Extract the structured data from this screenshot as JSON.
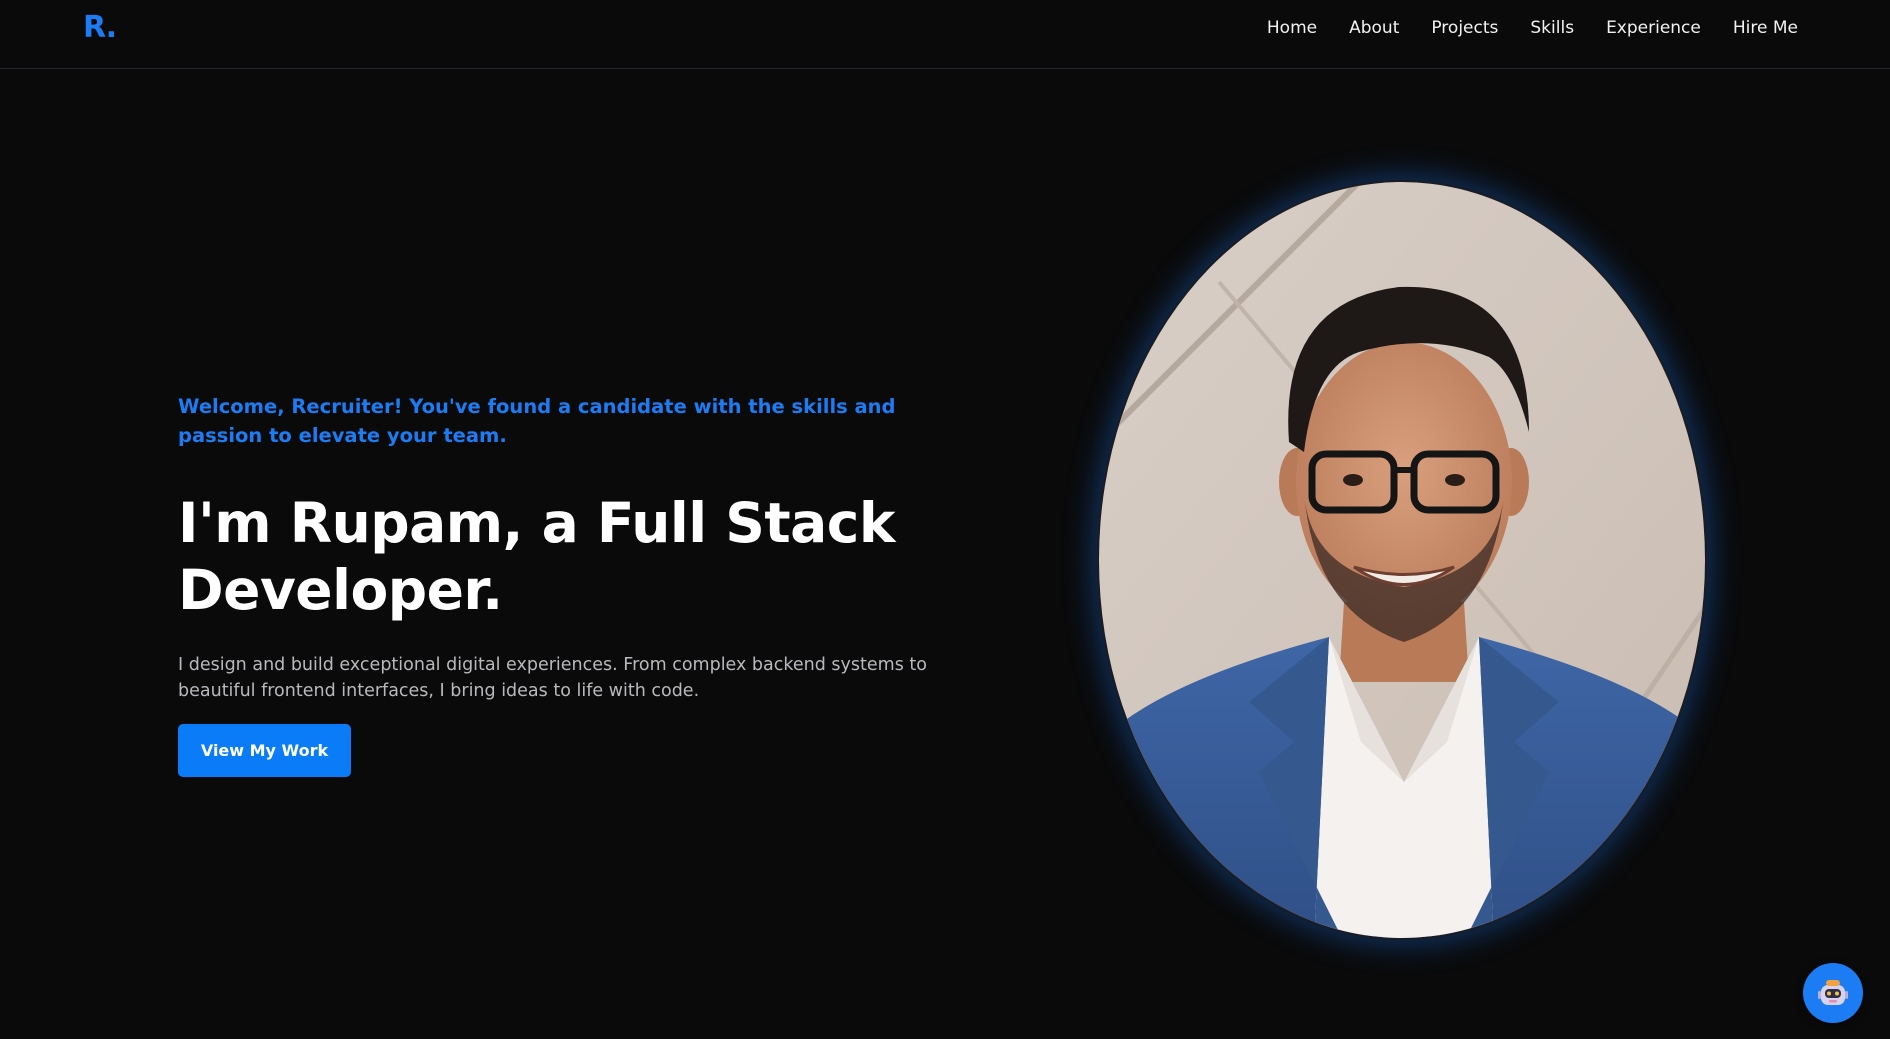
{
  "nav": {
    "logo": "R.",
    "links": [
      "Home",
      "About",
      "Projects",
      "Skills",
      "Experience",
      "Hire Me"
    ]
  },
  "hero": {
    "welcome": "Welcome, Recruiter! You've found a candidate with the skills and passion to elevate your team.",
    "headline": "I'm Rupam, a Full Stack Developer.",
    "intro": "I design and build exceptional digital experiences. From complex backend systems to beautiful frontend interfaces, I bring ideas to life with code.",
    "cta_label": "View My Work"
  },
  "icons": {
    "chatbot": "robot-icon",
    "portrait": "profile-photo"
  },
  "colors": {
    "accent": "#1c7cf4",
    "background": "#0a0a0b",
    "button": "#0a7cf7"
  }
}
